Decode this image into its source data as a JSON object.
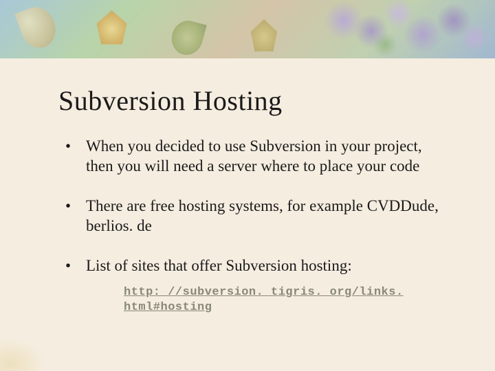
{
  "slide": {
    "title": "Subversion Hosting",
    "bullets": [
      "When you decided to use Subversion in your project, then you will need a server where to place your code",
      "There are free hosting systems, for example CVDDude, berlios. de",
      "List of sites that offer Subversion hosting:"
    ],
    "link": "http: //subversion. tigris. org/links. html#hosting"
  }
}
